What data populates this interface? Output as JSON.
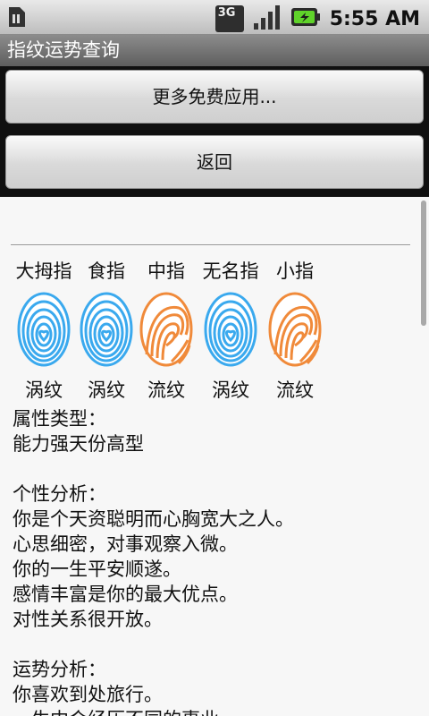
{
  "status_bar": {
    "time": "5:55 AM",
    "network_label": "3G",
    "icons": [
      "sim-card-icon",
      "3g-icon",
      "signal-icon",
      "battery-charging-icon"
    ]
  },
  "title_bar": {
    "title": "指纹运势查询"
  },
  "buttons": {
    "more_apps": "更多免费应用...",
    "back": "返回"
  },
  "fingers": [
    {
      "name": "大拇指",
      "type": "涡纹",
      "color": "#3aa9ee",
      "pattern": "whorl"
    },
    {
      "name": "食指",
      "type": "涡纹",
      "color": "#3aa9ee",
      "pattern": "whorl"
    },
    {
      "name": "中指",
      "type": "流纹",
      "color": "#f08a3a",
      "pattern": "loop"
    },
    {
      "name": "无名指",
      "type": "涡纹",
      "color": "#3aa9ee",
      "pattern": "whorl"
    },
    {
      "name": "小指",
      "type": "流纹",
      "color": "#f08a3a",
      "pattern": "loop"
    }
  ],
  "attribute": {
    "heading": "属性类型：",
    "value": "能力强天份高型"
  },
  "personality": {
    "heading": "个性分析：",
    "lines": [
      "你是个天资聪明而心胸宽大之人。",
      "心思细密，对事观察入微。",
      "你的一生平安顺遂。",
      "感情丰富是你的最大优点。",
      "对性关系很开放。"
    ]
  },
  "fortune": {
    "heading": "运势分析：",
    "lines": [
      "你喜欢到处旅行。",
      "一生中会经历不同的事业"
    ]
  }
}
